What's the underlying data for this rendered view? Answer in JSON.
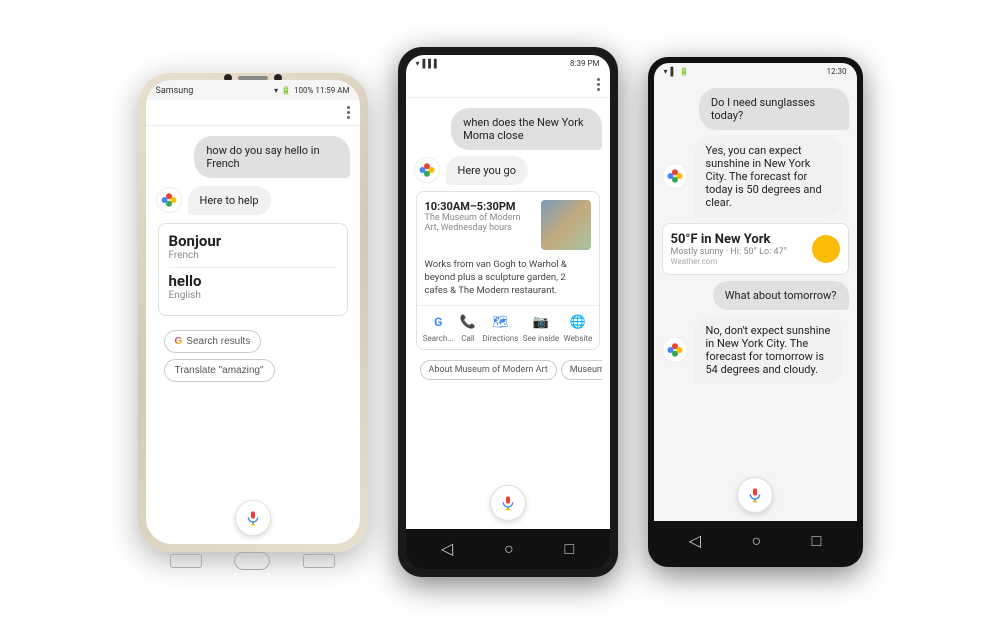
{
  "phone1": {
    "brand": "Samsung",
    "status_left": "Samsung",
    "status_right": "100% 11:59 AM",
    "chat": {
      "user_message": "how do you say hello in French",
      "assistant_message": "Here to help"
    },
    "translation_card": {
      "word1": "Bonjour",
      "lang1": "French",
      "word2": "hello",
      "lang2": "English"
    },
    "buttons": {
      "search": "Search results",
      "translate": "Translate \"amazing\""
    }
  },
  "phone2": {
    "status_right": "8:39 PM",
    "chat": {
      "user_message": "when does the New York Moma close",
      "assistant_message": "Here you go"
    },
    "museum_card": {
      "hours": "10:30AM–5:30PM",
      "name": "The Museum of Modern Art, Wednesday hours",
      "description": "Works from van Gogh to Warhol & beyond plus a sculpture garden, 2 cafes & The Modern restaurant.",
      "actions": [
        "Search...",
        "Call",
        "Directions",
        "See inside",
        "Website"
      ]
    },
    "chips": [
      "About Museum of Modern Art",
      "Museums i..."
    ],
    "search_label": "Search -"
  },
  "phone3": {
    "status_right": "12:30",
    "chat": [
      {
        "type": "user",
        "text": "Do I need sunglasses today?"
      },
      {
        "type": "assistant",
        "text": "Yes, you can expect sunshine in New York City. The forecast for today is 50 degrees and clear."
      },
      {
        "type": "weather",
        "temp": "50°F in New York",
        "desc": "Mostly sunny · Hi: 50° Lo: 47°",
        "source": "Weather.com"
      },
      {
        "type": "user",
        "text": "What about tomorrow?"
      },
      {
        "type": "assistant",
        "text": "No, don't expect sunshine in New York City. The forecast for tomorrow is 54 degrees and cloudy."
      }
    ]
  },
  "icons": {
    "mic": "🎤",
    "back": "◁",
    "home": "○",
    "recent": "□",
    "search_g": "G",
    "call": "📞",
    "directions": "▲",
    "see_inside": "📷",
    "website": "🌐"
  }
}
